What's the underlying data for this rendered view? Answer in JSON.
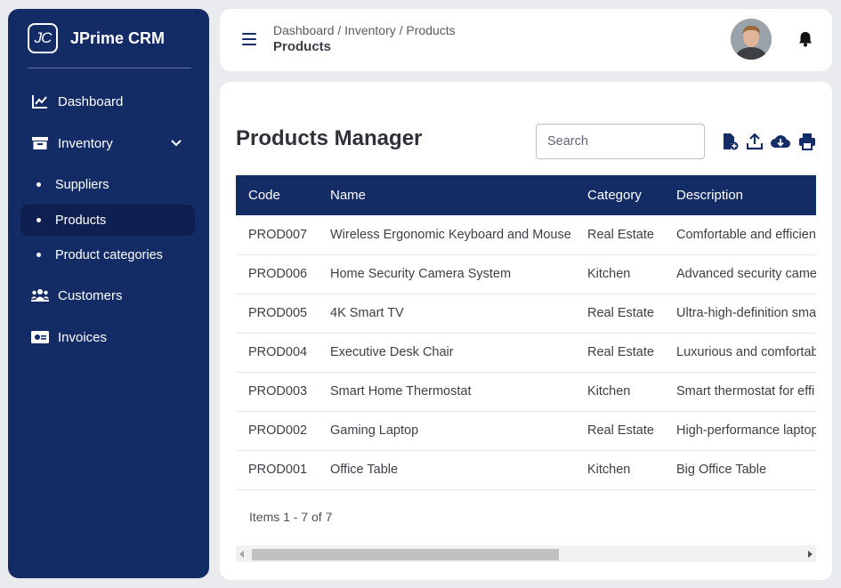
{
  "brand": {
    "logo": "JC",
    "name": "JPrime CRM"
  },
  "sidebar": {
    "items": [
      {
        "label": "Dashboard",
        "icon": "chart-line-icon"
      },
      {
        "label": "Inventory",
        "icon": "archive-icon"
      },
      {
        "label": "Customers",
        "icon": "users-icon"
      },
      {
        "label": "Invoices",
        "icon": "money-bill-icon"
      }
    ],
    "inventory_sub": [
      {
        "label": "Suppliers"
      },
      {
        "label": "Products",
        "active": true
      },
      {
        "label": "Product categories"
      }
    ]
  },
  "header": {
    "breadcrumb": "Dashboard / Inventory / Products",
    "title": "Products"
  },
  "main": {
    "title": "Products Manager",
    "search_placeholder": "Search",
    "toolbar": [
      "new-file-icon",
      "upload-icon",
      "cloud-download-icon",
      "print-icon"
    ],
    "columns": [
      "Code",
      "Name",
      "Category",
      "Description"
    ],
    "rows": [
      [
        "PROD007",
        "Wireless Ergonomic Keyboard and Mouse",
        "Real Estate",
        "Comfortable and efficien"
      ],
      [
        "PROD006",
        "Home Security Camera System",
        "Kitchen",
        "Advanced security came"
      ],
      [
        "PROD005",
        "4K Smart TV",
        "Real Estate",
        "Ultra-high-definition sma"
      ],
      [
        "PROD004",
        "Executive Desk Chair",
        "Real Estate",
        "Luxurious and comfortab"
      ],
      [
        "PROD003",
        "Smart Home Thermostat",
        "Kitchen",
        "Smart thermostat for effi"
      ],
      [
        "PROD002",
        "Gaming Laptop",
        "Real Estate",
        "High-performance laptop"
      ],
      [
        "PROD001",
        "Office Table",
        "Kitchen",
        "Big Office Table"
      ]
    ],
    "pager": "Items 1 - 7 of 7"
  },
  "colors": {
    "primary": "#142c66",
    "active": "#0e2050",
    "background": "#e9ebee"
  }
}
